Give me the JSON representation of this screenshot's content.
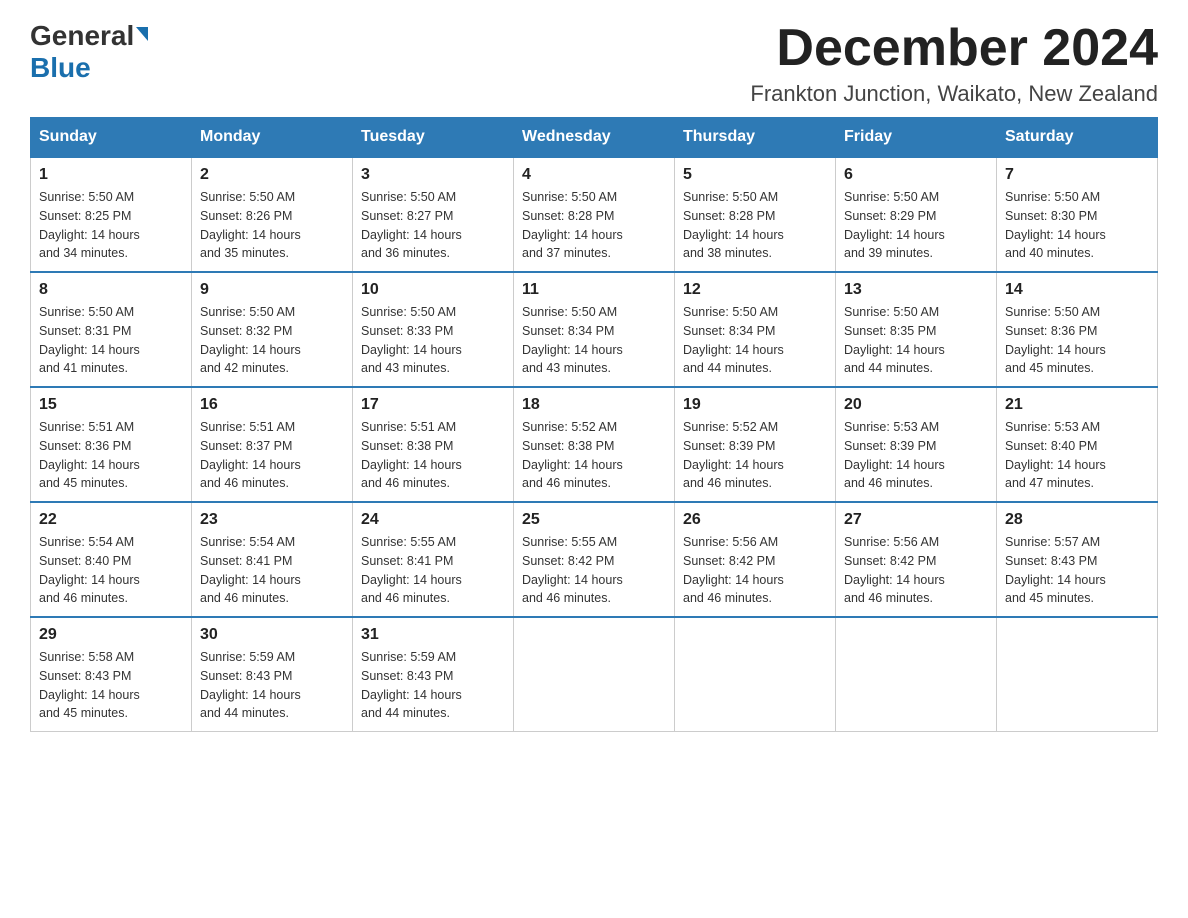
{
  "logo": {
    "general": "General",
    "blue": "Blue"
  },
  "header": {
    "title": "December 2024",
    "subtitle": "Frankton Junction, Waikato, New Zealand"
  },
  "weekdays": [
    "Sunday",
    "Monday",
    "Tuesday",
    "Wednesday",
    "Thursday",
    "Friday",
    "Saturday"
  ],
  "weeks": [
    [
      {
        "day": "1",
        "sunrise": "5:50 AM",
        "sunset": "8:25 PM",
        "daylight": "14 hours and 34 minutes."
      },
      {
        "day": "2",
        "sunrise": "5:50 AM",
        "sunset": "8:26 PM",
        "daylight": "14 hours and 35 minutes."
      },
      {
        "day": "3",
        "sunrise": "5:50 AM",
        "sunset": "8:27 PM",
        "daylight": "14 hours and 36 minutes."
      },
      {
        "day": "4",
        "sunrise": "5:50 AM",
        "sunset": "8:28 PM",
        "daylight": "14 hours and 37 minutes."
      },
      {
        "day": "5",
        "sunrise": "5:50 AM",
        "sunset": "8:28 PM",
        "daylight": "14 hours and 38 minutes."
      },
      {
        "day": "6",
        "sunrise": "5:50 AM",
        "sunset": "8:29 PM",
        "daylight": "14 hours and 39 minutes."
      },
      {
        "day": "7",
        "sunrise": "5:50 AM",
        "sunset": "8:30 PM",
        "daylight": "14 hours and 40 minutes."
      }
    ],
    [
      {
        "day": "8",
        "sunrise": "5:50 AM",
        "sunset": "8:31 PM",
        "daylight": "14 hours and 41 minutes."
      },
      {
        "day": "9",
        "sunrise": "5:50 AM",
        "sunset": "8:32 PM",
        "daylight": "14 hours and 42 minutes."
      },
      {
        "day": "10",
        "sunrise": "5:50 AM",
        "sunset": "8:33 PM",
        "daylight": "14 hours and 43 minutes."
      },
      {
        "day": "11",
        "sunrise": "5:50 AM",
        "sunset": "8:34 PM",
        "daylight": "14 hours and 43 minutes."
      },
      {
        "day": "12",
        "sunrise": "5:50 AM",
        "sunset": "8:34 PM",
        "daylight": "14 hours and 44 minutes."
      },
      {
        "day": "13",
        "sunrise": "5:50 AM",
        "sunset": "8:35 PM",
        "daylight": "14 hours and 44 minutes."
      },
      {
        "day": "14",
        "sunrise": "5:50 AM",
        "sunset": "8:36 PM",
        "daylight": "14 hours and 45 minutes."
      }
    ],
    [
      {
        "day": "15",
        "sunrise": "5:51 AM",
        "sunset": "8:36 PM",
        "daylight": "14 hours and 45 minutes."
      },
      {
        "day": "16",
        "sunrise": "5:51 AM",
        "sunset": "8:37 PM",
        "daylight": "14 hours and 46 minutes."
      },
      {
        "day": "17",
        "sunrise": "5:51 AM",
        "sunset": "8:38 PM",
        "daylight": "14 hours and 46 minutes."
      },
      {
        "day": "18",
        "sunrise": "5:52 AM",
        "sunset": "8:38 PM",
        "daylight": "14 hours and 46 minutes."
      },
      {
        "day": "19",
        "sunrise": "5:52 AM",
        "sunset": "8:39 PM",
        "daylight": "14 hours and 46 minutes."
      },
      {
        "day": "20",
        "sunrise": "5:53 AM",
        "sunset": "8:39 PM",
        "daylight": "14 hours and 46 minutes."
      },
      {
        "day": "21",
        "sunrise": "5:53 AM",
        "sunset": "8:40 PM",
        "daylight": "14 hours and 47 minutes."
      }
    ],
    [
      {
        "day": "22",
        "sunrise": "5:54 AM",
        "sunset": "8:40 PM",
        "daylight": "14 hours and 46 minutes."
      },
      {
        "day": "23",
        "sunrise": "5:54 AM",
        "sunset": "8:41 PM",
        "daylight": "14 hours and 46 minutes."
      },
      {
        "day": "24",
        "sunrise": "5:55 AM",
        "sunset": "8:41 PM",
        "daylight": "14 hours and 46 minutes."
      },
      {
        "day": "25",
        "sunrise": "5:55 AM",
        "sunset": "8:42 PM",
        "daylight": "14 hours and 46 minutes."
      },
      {
        "day": "26",
        "sunrise": "5:56 AM",
        "sunset": "8:42 PM",
        "daylight": "14 hours and 46 minutes."
      },
      {
        "day": "27",
        "sunrise": "5:56 AM",
        "sunset": "8:42 PM",
        "daylight": "14 hours and 46 minutes."
      },
      {
        "day": "28",
        "sunrise": "5:57 AM",
        "sunset": "8:43 PM",
        "daylight": "14 hours and 45 minutes."
      }
    ],
    [
      {
        "day": "29",
        "sunrise": "5:58 AM",
        "sunset": "8:43 PM",
        "daylight": "14 hours and 45 minutes."
      },
      {
        "day": "30",
        "sunrise": "5:59 AM",
        "sunset": "8:43 PM",
        "daylight": "14 hours and 44 minutes."
      },
      {
        "day": "31",
        "sunrise": "5:59 AM",
        "sunset": "8:43 PM",
        "daylight": "14 hours and 44 minutes."
      },
      null,
      null,
      null,
      null
    ]
  ],
  "labels": {
    "sunrise": "Sunrise:",
    "sunset": "Sunset:",
    "daylight": "Daylight:"
  }
}
